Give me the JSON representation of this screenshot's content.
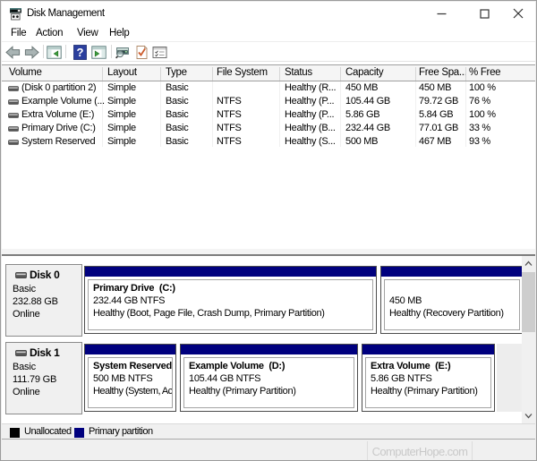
{
  "window": {
    "title": "Disk Management",
    "controls": {
      "minimize": "minimize",
      "maximize": "maximize",
      "close": "close"
    }
  },
  "menu": {
    "items": {
      "file": "File",
      "action": "Action",
      "view": "View",
      "help": "Help"
    }
  },
  "toolbar": {
    "icons": [
      "back",
      "forward",
      "show-console-tree",
      "help",
      "show-action-pane",
      "rescan-disks",
      "check-document",
      "properties"
    ]
  },
  "volume_table": {
    "columns": {
      "volume": "Volume",
      "layout": "Layout",
      "type": "Type",
      "fs": "File System",
      "status": "Status",
      "capacity": "Capacity",
      "free": "Free Spa...",
      "pct": "% Free"
    },
    "rows": [
      {
        "volume": "(Disk 0 partition 2)",
        "layout": "Simple",
        "type": "Basic",
        "fs": "",
        "status": "Healthy (R...",
        "capacity": "450 MB",
        "free": "450 MB",
        "pct": "100 %"
      },
      {
        "volume": "Example Volume (...",
        "layout": "Simple",
        "type": "Basic",
        "fs": "NTFS",
        "status": "Healthy (P...",
        "capacity": "105.44 GB",
        "free": "79.72 GB",
        "pct": "76 %"
      },
      {
        "volume": "Extra Volume (E:)",
        "layout": "Simple",
        "type": "Basic",
        "fs": "NTFS",
        "status": "Healthy (P...",
        "capacity": "5.86 GB",
        "free": "5.84 GB",
        "pct": "100 %"
      },
      {
        "volume": "Primary Drive (C:)",
        "layout": "Simple",
        "type": "Basic",
        "fs": "NTFS",
        "status": "Healthy (B...",
        "capacity": "232.44 GB",
        "free": "77.01 GB",
        "pct": "33 %"
      },
      {
        "volume": "System Reserved",
        "layout": "Simple",
        "type": "Basic",
        "fs": "NTFS",
        "status": "Healthy (S...",
        "capacity": "500 MB",
        "free": "467 MB",
        "pct": "93 %"
      }
    ]
  },
  "disks": [
    {
      "name": "Disk 0",
      "kind": "Basic",
      "size": "232.88 GB",
      "state": "Online",
      "partitions": [
        {
          "title": "Primary Drive  (C:)",
          "line2": "232.44 GB NTFS",
          "line3": "Healthy (Boot, Page File, Crash Dump, Primary Partition)"
        },
        {
          "title": "",
          "line2": "450 MB",
          "line3": "Healthy (Recovery Partition)"
        }
      ]
    },
    {
      "name": "Disk 1",
      "kind": "Basic",
      "size": "111.79 GB",
      "state": "Online",
      "partitions": [
        {
          "title": "System Reserved",
          "line2": "500 MB NTFS",
          "line3": "Healthy (System, Act"
        },
        {
          "title": "Example Volume  (D:)",
          "line2": "105.44 GB NTFS",
          "line3": "Healthy (Primary Partition)"
        },
        {
          "title": "Extra Volume  (E:)",
          "line2": "5.86 GB NTFS",
          "line3": "Healthy (Primary Partition)"
        }
      ]
    }
  ],
  "legend": {
    "items": [
      {
        "label": "Unallocated",
        "color": "#000000"
      },
      {
        "label": "Primary partition",
        "color": "#00007e"
      }
    ]
  },
  "statusbar": {
    "watermark": "ComputerHope.com"
  },
  "colors": {
    "primary_partition_band": "#00007e",
    "unallocated": "#000000",
    "panel_gray": "#f0f0f0",
    "help_icon_blue": "#2b3f9e"
  }
}
